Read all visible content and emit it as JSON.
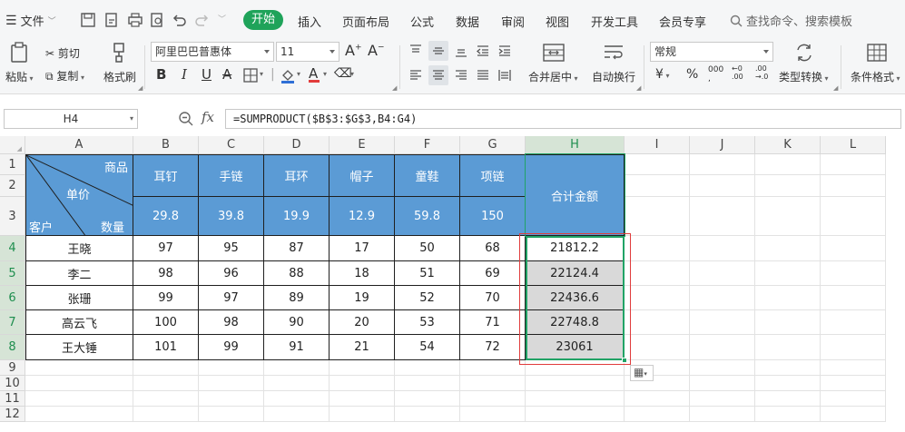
{
  "menubar": {
    "file_label": "文件",
    "tabs": [
      "开始",
      "插入",
      "页面布局",
      "公式",
      "数据",
      "审阅",
      "视图",
      "开发工具",
      "会员专享"
    ],
    "search_placeholder": "查找命令、搜索模板"
  },
  "ribbon": {
    "paste": "粘贴",
    "cut": "剪切",
    "copy": "复制",
    "format_painter": "格式刷",
    "font_name": "阿里巴巴普惠体",
    "font_size": "11",
    "bold": "B",
    "italic": "I",
    "underline": "U",
    "merge_center": "合并居中",
    "wrap_text": "自动换行",
    "number_format": "常规",
    "currency": "¥",
    "percent": "%",
    "thousands": "000",
    "type_convert": "类型转换",
    "cond_format": "条件格式"
  },
  "formula_bar": {
    "name_box": "H4",
    "fx": "fx",
    "formula": "=SUMPRODUCT($B$3:$G$3,B4:G4)"
  },
  "grid": {
    "columns": [
      "A",
      "B",
      "C",
      "D",
      "E",
      "F",
      "G",
      "H",
      "I",
      "J",
      "K",
      "L"
    ],
    "rows": [
      "1",
      "2",
      "3",
      "4",
      "5",
      "6",
      "7",
      "8",
      "9",
      "10",
      "11",
      "12"
    ],
    "diag_header": {
      "top": "商品",
      "mid": "单价",
      "bottom_left": "客户",
      "bottom_right": "数量"
    },
    "products": [
      "耳钉",
      "手链",
      "耳环",
      "帽子",
      "童鞋",
      "项链"
    ],
    "prices": [
      "29.8",
      "39.8",
      "19.9",
      "12.9",
      "59.8",
      "150"
    ],
    "total_header": "合计金额",
    "customers": [
      {
        "name": "王晓",
        "qty": [
          "97",
          "95",
          "87",
          "17",
          "50",
          "68"
        ],
        "total": "21812.2"
      },
      {
        "name": "李二",
        "qty": [
          "98",
          "96",
          "88",
          "18",
          "51",
          "69"
        ],
        "total": "22124.4"
      },
      {
        "name": "张珊",
        "qty": [
          "99",
          "97",
          "89",
          "19",
          "52",
          "70"
        ],
        "total": "22436.6"
      },
      {
        "name": "高云飞",
        "qty": [
          "100",
          "98",
          "90",
          "20",
          "53",
          "71"
        ],
        "total": "22748.8"
      },
      {
        "name": "王大锤",
        "qty": [
          "101",
          "99",
          "91",
          "21",
          "54",
          "72"
        ],
        "total": "23061"
      }
    ]
  },
  "colors": {
    "accent": "#1fa35a",
    "header_fill": "#5b9bd5",
    "selection": "#21a366",
    "red_box": "#e03c3c"
  }
}
